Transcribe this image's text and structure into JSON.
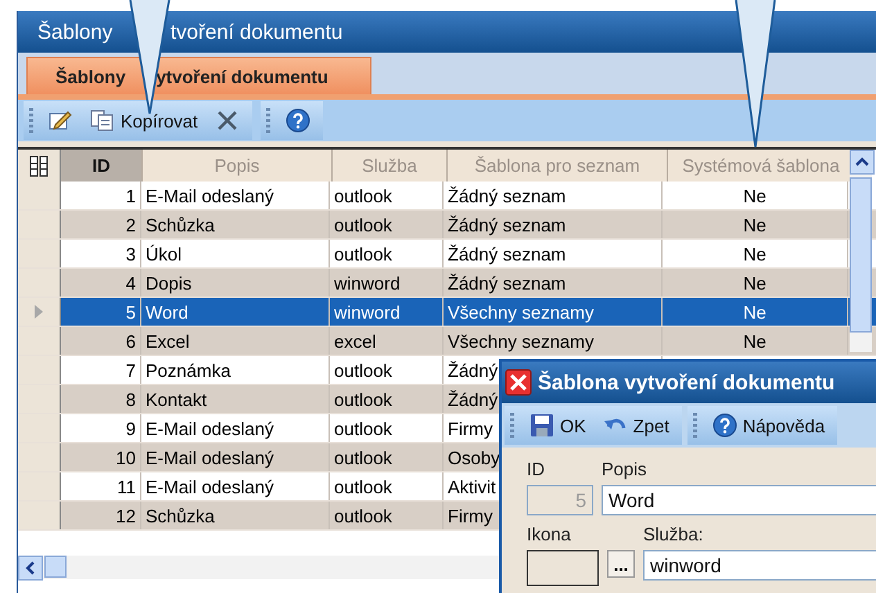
{
  "window": {
    "title_parts": [
      "Šablony",
      "tvoření dokumentu"
    ]
  },
  "tabs": [
    {
      "label_parts": [
        "Šablony",
        "ytvoření dokumentu"
      ],
      "selected": true
    }
  ],
  "toolbar": {
    "groups": [
      [
        {
          "kind": "edit"
        },
        {
          "kind": "copy",
          "label": "Kopírovat"
        },
        {
          "kind": "delete"
        }
      ],
      [
        {
          "kind": "help"
        }
      ]
    ]
  },
  "table": {
    "columns": [
      "ID",
      "Popis",
      "Služba",
      "Šablona pro seznam",
      "Systémová šablona"
    ],
    "rows": [
      {
        "cells": [
          "1",
          "E-Mail odeslaný",
          "outlook",
          "Žádný seznam",
          "Ne"
        ],
        "selected": false
      },
      {
        "cells": [
          "2",
          "Schůzka",
          "outlook",
          "Žádný seznam",
          "Ne"
        ],
        "selected": false
      },
      {
        "cells": [
          "3",
          "Úkol",
          "outlook",
          "Žádný seznam",
          "Ne"
        ],
        "selected": false
      },
      {
        "cells": [
          "4",
          "Dopis",
          "winword",
          "Žádný seznam",
          "Ne"
        ],
        "selected": false
      },
      {
        "cells": [
          "5",
          "Word",
          "winword",
          "Všechny seznamy",
          "Ne"
        ],
        "selected": true
      },
      {
        "cells": [
          "6",
          "Excel",
          "excel",
          "Všechny seznamy",
          "Ne"
        ],
        "selected": false
      },
      {
        "cells": [
          "7",
          "Poznámka",
          "outlook",
          "Žádný"
        ],
        "selected": false
      },
      {
        "cells": [
          "8",
          "Kontakt",
          "outlook",
          "Žádný"
        ],
        "selected": false
      },
      {
        "cells": [
          "9",
          "E-Mail odeslaný",
          "outlook",
          "Firmy"
        ],
        "selected": false
      },
      {
        "cells": [
          "10",
          "E-Mail odeslaný",
          "outlook",
          "Osoby"
        ],
        "selected": false
      },
      {
        "cells": [
          "11",
          "E-Mail odeslaný",
          "outlook",
          "Aktivit"
        ],
        "selected": false
      },
      {
        "cells": [
          "12",
          "Schůzka",
          "outlook",
          "Firmy"
        ],
        "selected": false
      }
    ]
  },
  "dialog": {
    "title": "Šablona vytvoření dokumentu",
    "toolbar": {
      "groups": [
        [
          {
            "kind": "save",
            "label": "OK"
          },
          {
            "kind": "undo",
            "label": "Zpet"
          }
        ],
        [
          {
            "kind": "help",
            "label": "Nápověda"
          }
        ]
      ]
    },
    "id": {
      "label": "ID",
      "value": "5",
      "disabled": true
    },
    "popis": {
      "label": "Popis",
      "value": "Word"
    },
    "ikona": {
      "label": "Ikona",
      "button": "..."
    },
    "sluzba": {
      "label": "Služba:",
      "value": "winword"
    }
  }
}
